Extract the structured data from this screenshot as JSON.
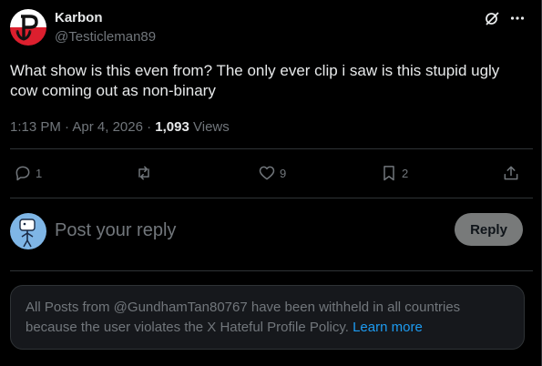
{
  "post": {
    "author_name": "Karbon",
    "author_handle": "@Testicleman89",
    "text": "What show is this even from? The only ever clip i saw is this stupid ugly cow coming out as non-binary",
    "time": "1:13 PM",
    "separator": " · ",
    "date": "Apr 4, 2026",
    "views_count": "1,093",
    "views_label": " Views"
  },
  "actions": {
    "replies": "1",
    "reposts": "",
    "likes": "9",
    "bookmarks": "2"
  },
  "reply_box": {
    "placeholder": "Post your reply",
    "button_label": "Reply"
  },
  "notice": {
    "text": "All Posts from @GundhamTan80767 have been withheld in all countries because the user violates the X Hateful Profile Policy. ",
    "link_label": "Learn more"
  },
  "colors": {
    "background": "#000000",
    "text": "#e7e9ea",
    "muted": "#71767b",
    "link": "#1d9bf0",
    "divider": "#2f3336",
    "avatar_red": "#dc1f2e"
  },
  "icons": [
    "polish-anchor-avatar",
    "grok-icon",
    "more-icon",
    "reply-icon",
    "repost-icon",
    "like-icon",
    "bookmark-icon",
    "share-icon",
    "stick-figure-avatar"
  ]
}
